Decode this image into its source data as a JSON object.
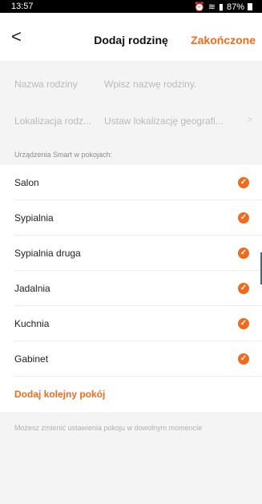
{
  "status_bar": {
    "time": "13:57",
    "battery": "87%"
  },
  "header": {
    "back": "<",
    "title": "Dodaj rodzinę",
    "done": "Zakończone"
  },
  "form": {
    "family_name_label": "Nazwa rodziny",
    "family_name_placeholder": "Wpisz nazwę rodziny.",
    "location_label": "Lokalizacja rodz...",
    "location_placeholder": "Ustaw lokalizację geografi...",
    "location_arrow": ">"
  },
  "rooms": {
    "section_title": "Urządzenia Smart w pokojach:",
    "items": [
      {
        "label": "Salon",
        "checked": true
      },
      {
        "label": "Sypialnia",
        "checked": true
      },
      {
        "label": "Sypialnia druga",
        "checked": true
      },
      {
        "label": "Jadalnia",
        "checked": true
      },
      {
        "label": "Kuchnia",
        "checked": true
      },
      {
        "label": "Gabinet",
        "checked": true
      }
    ],
    "check_glyph": "✓",
    "add_room": "Dodaj kolejny pokój"
  },
  "footer_note": "Możesz zmienić ustawienia pokoju w dowolnym momencie",
  "colors": {
    "accent": "#f26a1b"
  }
}
